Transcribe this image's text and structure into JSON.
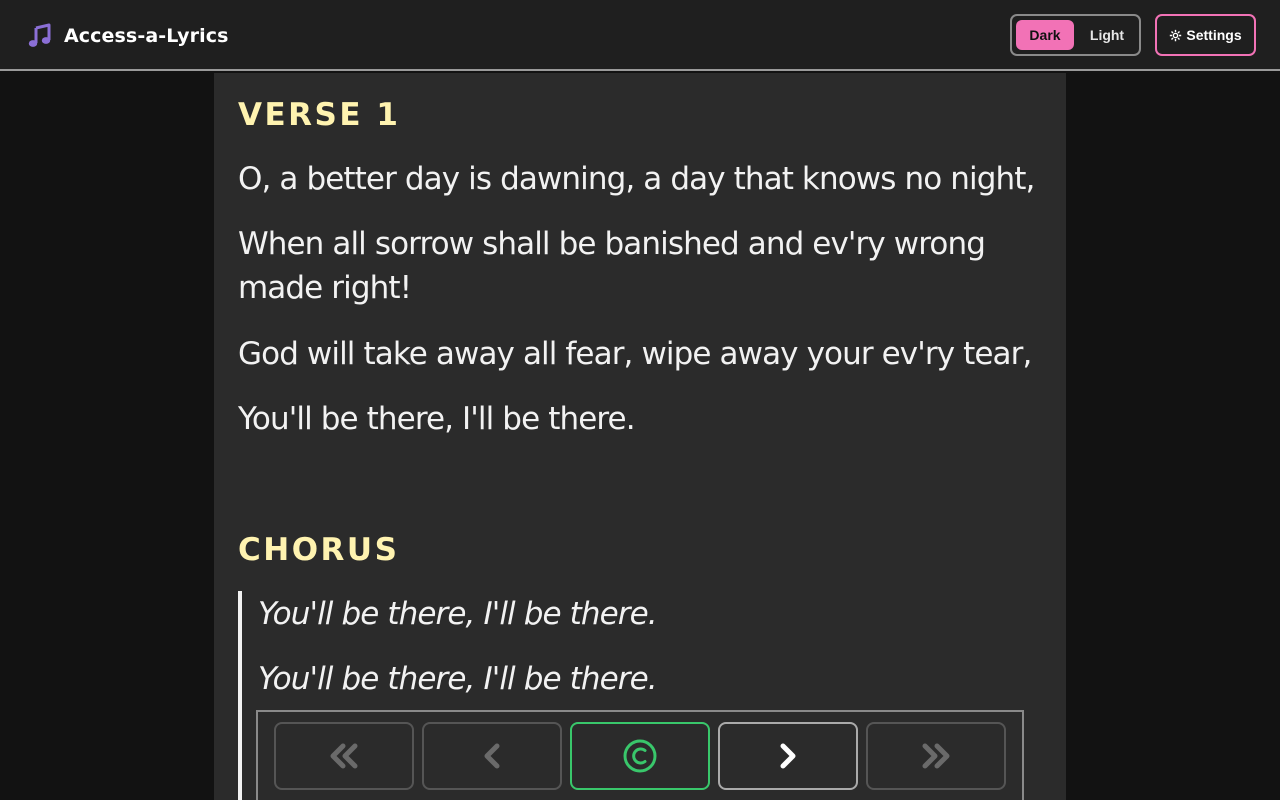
{
  "app": {
    "title": "Access-a-Lyrics"
  },
  "header": {
    "theme": {
      "dark_label": "Dark",
      "light_label": "Light",
      "active": "Dark"
    },
    "settings_label": "Settings"
  },
  "lyrics": {
    "verse1": {
      "heading": "VERSE 1",
      "lines": [
        "O, a better day is dawning, a day that knows no night,",
        "When all sorrow shall be banished and ev'ry wrong made right!",
        "God will take away all fear, wipe away your ev'ry tear,",
        "You'll be there, I'll be there."
      ]
    },
    "chorus": {
      "heading": "CHORUS",
      "lines": [
        "You'll be there, I'll be there.",
        "You'll be there, I'll be there."
      ]
    }
  },
  "navigation": {
    "buttons": [
      {
        "icon": "double-chevron-left-icon",
        "state": "enabled"
      },
      {
        "icon": "chevron-left-icon",
        "state": "enabled"
      },
      {
        "icon": "chorus-c-icon",
        "state": "current"
      },
      {
        "icon": "chevron-right-icon",
        "state": "enabled"
      },
      {
        "icon": "double-chevron-right-icon",
        "state": "enabled"
      }
    ]
  },
  "colors": {
    "accent_pink": "#f272b6",
    "heading_yellow": "#fff3b0",
    "chorus_green": "#39c76b",
    "brand_icon_purple": "#8b6fd6",
    "panel_bg": "#2b2b2b",
    "page_bg": "#121212",
    "header_bg": "#1f1f1f"
  }
}
